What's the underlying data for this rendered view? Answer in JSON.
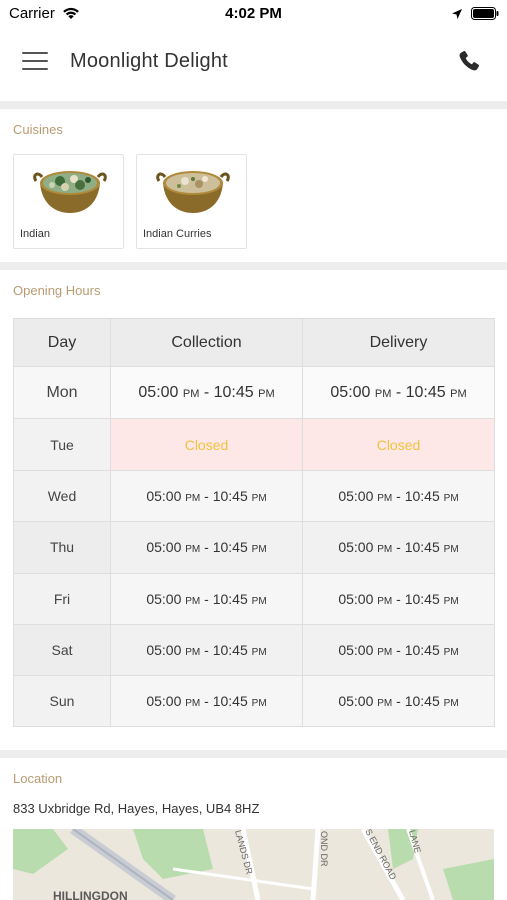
{
  "status_bar": {
    "carrier": "Carrier",
    "time": "4:02 PM"
  },
  "header": {
    "title": "Moonlight Delight"
  },
  "cuisines": {
    "heading": "Cuisines",
    "items": [
      {
        "name": "Indian"
      },
      {
        "name": "Indian Curries"
      }
    ]
  },
  "opening_hours": {
    "heading": "Opening Hours",
    "columns": [
      "Day",
      "Collection",
      "Delivery"
    ],
    "closed_label": "Closed",
    "rows": [
      {
        "day": "Mon",
        "collection": {
          "open": "05:00",
          "open_ampm": "PM",
          "close": "10:45",
          "close_ampm": "PM"
        },
        "delivery": {
          "open": "05:00",
          "open_ampm": "PM",
          "close": "10:45",
          "close_ampm": "PM"
        }
      },
      {
        "day": "Tue",
        "collection": {
          "open": "Closed",
          "open_ampm": "",
          "close": "",
          "close_ampm": ""
        },
        "delivery": {
          "open": "Closed",
          "open_ampm": "",
          "close": "",
          "close_ampm": ""
        }
      },
      {
        "day": "Wed",
        "collection": {
          "open": "05:00",
          "open_ampm": "PM",
          "close": "10:45",
          "close_ampm": "PM"
        },
        "delivery": {
          "open": "05:00",
          "open_ampm": "PM",
          "close": "10:45",
          "close_ampm": "PM"
        }
      },
      {
        "day": "Thu",
        "collection": {
          "open": "05:00",
          "open_ampm": "PM",
          "close": "10:45",
          "close_ampm": "PM"
        },
        "delivery": {
          "open": "05:00",
          "open_ampm": "PM",
          "close": "10:45",
          "close_ampm": "PM"
        }
      },
      {
        "day": "Fri",
        "collection": {
          "open": "05:00",
          "open_ampm": "PM",
          "close": "10:45",
          "close_ampm": "PM"
        },
        "delivery": {
          "open": "05:00",
          "open_ampm": "PM",
          "close": "10:45",
          "close_ampm": "PM"
        }
      },
      {
        "day": "Sat",
        "collection": {
          "open": "05:00",
          "open_ampm": "PM",
          "close": "10:45",
          "close_ampm": "PM"
        },
        "delivery": {
          "open": "05:00",
          "open_ampm": "PM",
          "close": "10:45",
          "close_ampm": "PM"
        }
      },
      {
        "day": "Sun",
        "collection": {
          "open": "05:00",
          "open_ampm": "PM",
          "close": "10:45",
          "close_ampm": "PM"
        },
        "delivery": {
          "open": "05:00",
          "open_ampm": "PM",
          "close": "10:45",
          "close_ampm": "PM"
        }
      }
    ]
  },
  "location": {
    "heading": "Location",
    "address": "833 Uxbridge Rd, Hayes, Hayes, UB4 8HZ",
    "map_labels": {
      "area": "HILLINGDON",
      "road_a": "LANDS DR",
      "road_b": "OND DR",
      "road_c": "S END ROAD",
      "road_d": "LANE"
    }
  },
  "colors": {
    "accent_label": "#b89b72",
    "closed_bg": "#fde7e7",
    "closed_text": "#f0c43e"
  }
}
